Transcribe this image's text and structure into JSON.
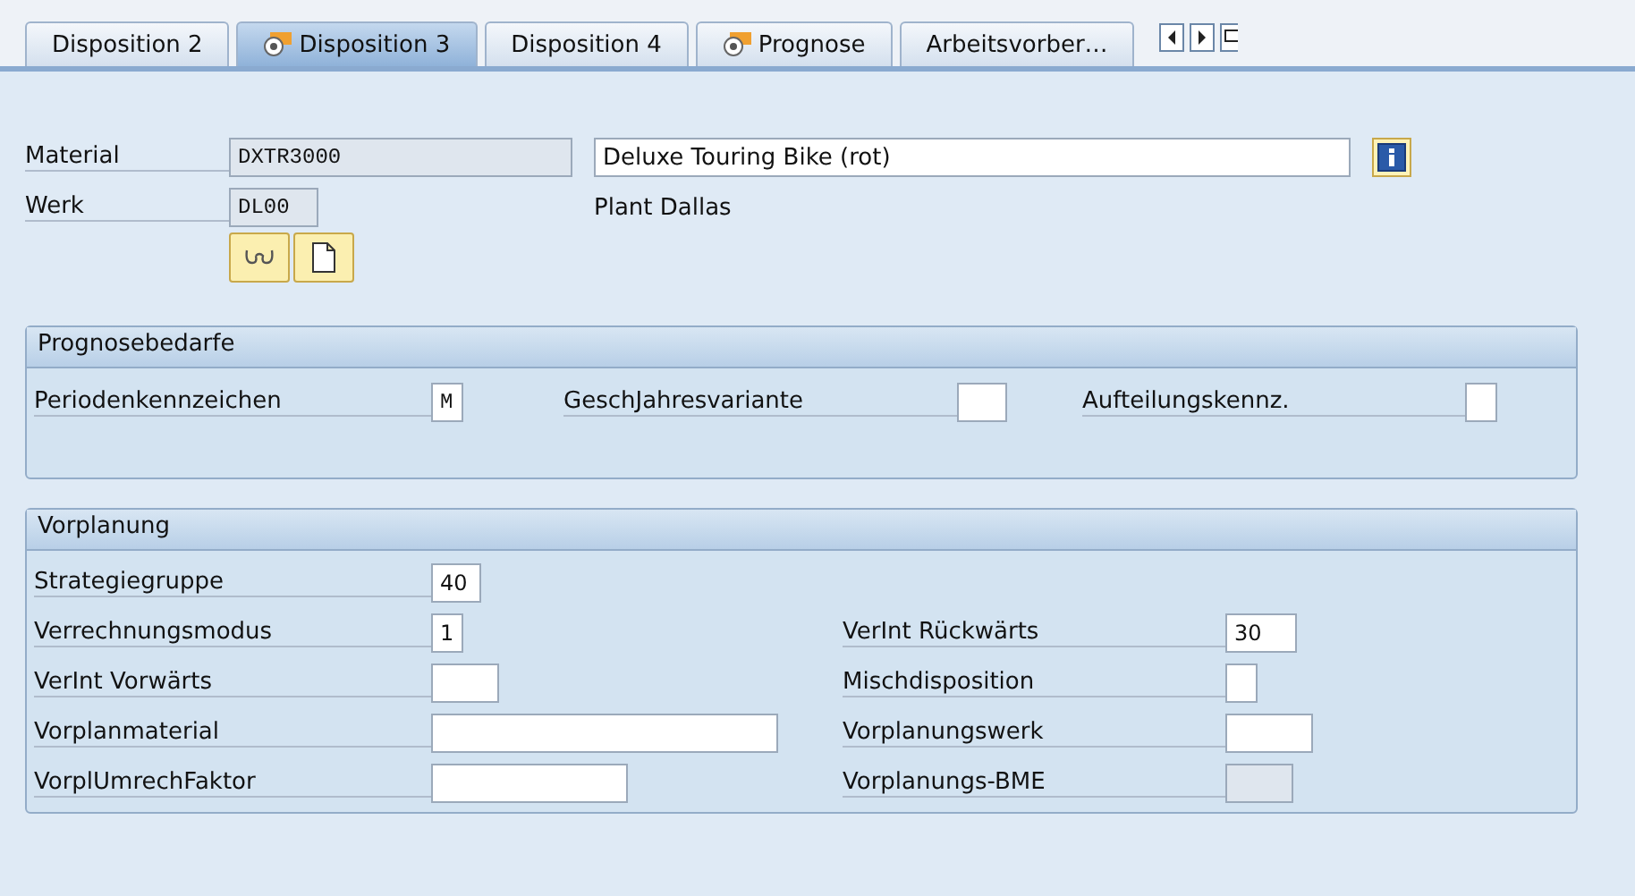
{
  "tabs": [
    {
      "label": "Disposition 2",
      "selected": false,
      "flagged": false
    },
    {
      "label": "Disposition 3",
      "selected": true,
      "flagged": true
    },
    {
      "label": "Disposition 4",
      "selected": false,
      "flagged": false
    },
    {
      "label": "Prognose",
      "selected": false,
      "flagged": true
    },
    {
      "label": "Arbeitsvorber…",
      "selected": false,
      "flagged": false
    }
  ],
  "header": {
    "material": {
      "label": "Material",
      "value": "DXTR3000",
      "disabled": true
    },
    "description": {
      "value": "Deluxe Touring Bike (rot)",
      "disabled": false
    },
    "plant": {
      "label": "Werk",
      "value": "DL00",
      "disabled": true
    },
    "plant_name": "Plant Dallas"
  },
  "prognosebedarfe": {
    "title": "Prognosebedarfe",
    "fields": [
      {
        "label": "Periodenkennzeichen",
        "value": "M",
        "disabled": false
      },
      {
        "label": "GeschJahresvariante",
        "disabled": false
      },
      {
        "label": "Aufteilungskennz.",
        "disabled": false
      }
    ]
  },
  "vorplanung": {
    "title": "Vorplanung",
    "rows": [
      {
        "left": {
          "label": "Strategiegruppe",
          "value": "40",
          "disabled": false
        }
      },
      {
        "left": {
          "label": "Verrechnungsmodus",
          "value": "1",
          "disabled": false
        },
        "right": {
          "label": "VerInt Rückwärts",
          "value": "30",
          "disabled": false
        }
      },
      {
        "left": {
          "label": "VerInt Vorwärts",
          "disabled": false
        },
        "right": {
          "label": "Mischdisposition",
          "disabled": false
        }
      },
      {
        "left": {
          "label": "Vorplanmaterial",
          "disabled": false
        },
        "right": {
          "label": "Vorplanungswerk",
          "disabled": false
        }
      },
      {
        "left": {
          "label": "VorplUmrechFaktor",
          "disabled": false
        },
        "right": {
          "label": "Vorplanungs-BME",
          "disabled": true
        }
      }
    ]
  }
}
